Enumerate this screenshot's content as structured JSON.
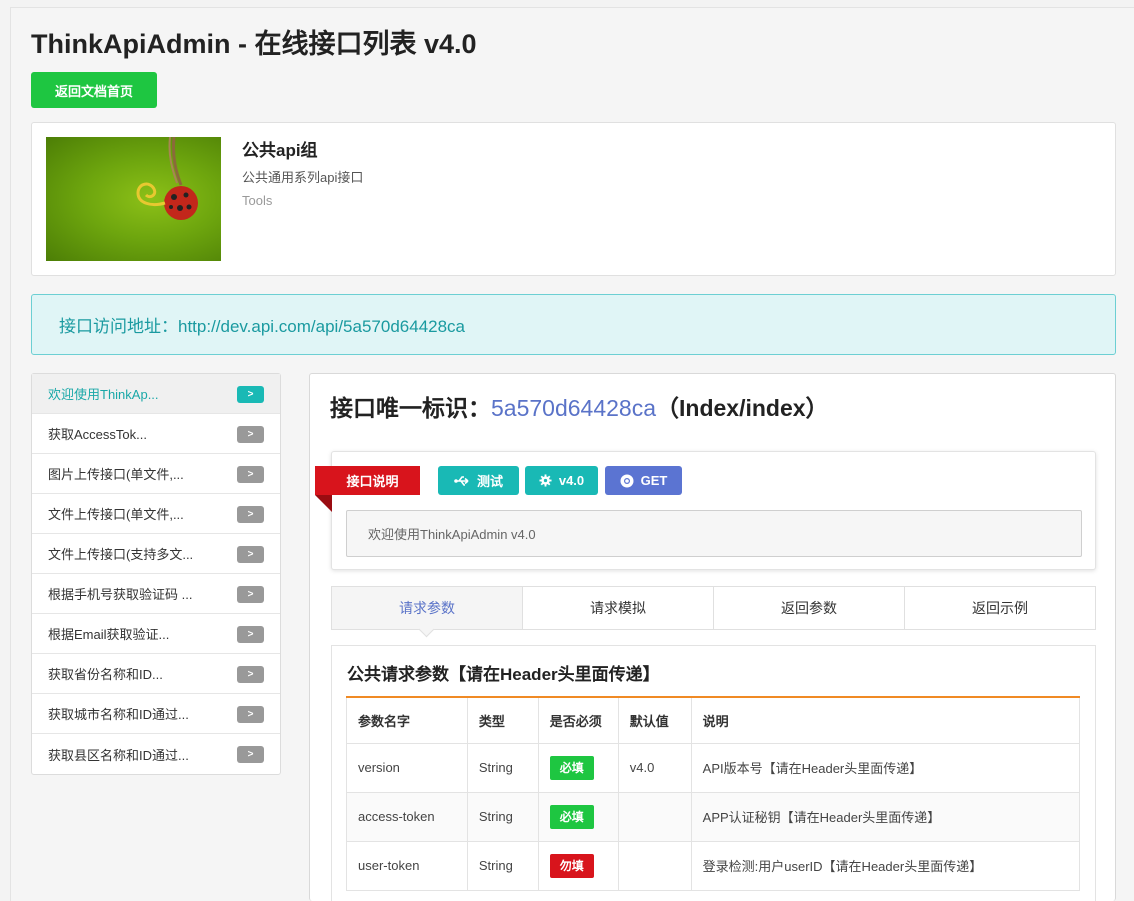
{
  "page": {
    "title": "ThinkApiAdmin - 在线接口列表 v4.0",
    "back_button": "返回文档首页"
  },
  "group": {
    "name": "公共api组",
    "description": "公共通用系列api接口",
    "tag": "Tools"
  },
  "url_bar": {
    "text": "接口访问地址：http://dev.api.com/api/5a570d64428ca"
  },
  "sidebar": {
    "items": [
      {
        "label": "欢迎使用ThinkAp...",
        "arrow": ">",
        "active": true
      },
      {
        "label": "获取AccessTok...",
        "arrow": ">"
      },
      {
        "label": "图片上传接口(单文件,...",
        "arrow": ">"
      },
      {
        "label": "文件上传接口(单文件,...",
        "arrow": ">"
      },
      {
        "label": "文件上传接口(支持多文...",
        "arrow": ">"
      },
      {
        "label": "根据手机号获取验证码 ...",
        "arrow": ">"
      },
      {
        "label": "根据Email获取验证...",
        "arrow": ">"
      },
      {
        "label": "获取省份名称和ID...",
        "arrow": ">"
      },
      {
        "label": "获取城市名称和ID通过...",
        "arrow": ">"
      },
      {
        "label": "获取县区名称和ID通过...",
        "arrow": ">"
      }
    ]
  },
  "main": {
    "id_label": "接口唯一标识：",
    "id_hash": "5a570d64428ca",
    "id_route": "（Index/index）",
    "ribbon": "接口说明",
    "pills": {
      "test": "测试",
      "version": "v4.0",
      "method": "GET"
    },
    "description": "欢迎使用ThinkApiAdmin v4.0",
    "tabs": [
      "请求参数",
      "请求模拟",
      "返回参数",
      "返回示例"
    ],
    "params_title": "公共请求参数【请在Header头里面传递】",
    "table": {
      "headers": [
        "参数名字",
        "类型",
        "是否必须",
        "默认值",
        "说明"
      ],
      "rows": [
        {
          "name": "version",
          "type": "String",
          "required": "必填",
          "default": "v4.0",
          "desc": "API版本号【请在Header头里面传递】"
        },
        {
          "name": "access-token",
          "type": "String",
          "required": "必填",
          "default": "",
          "desc": "APP认证秘钥【请在Header头里面传递】"
        },
        {
          "name": "user-token",
          "type": "String",
          "required": "勿填",
          "default": "",
          "desc": "登录检测:用户userID【请在Header头里面传递】"
        }
      ]
    }
  },
  "colors": {
    "green": "#1ec641",
    "teal": "#19b9b5",
    "blue": "#5b74d2",
    "red": "#d8141c",
    "orange": "#f08a24"
  }
}
